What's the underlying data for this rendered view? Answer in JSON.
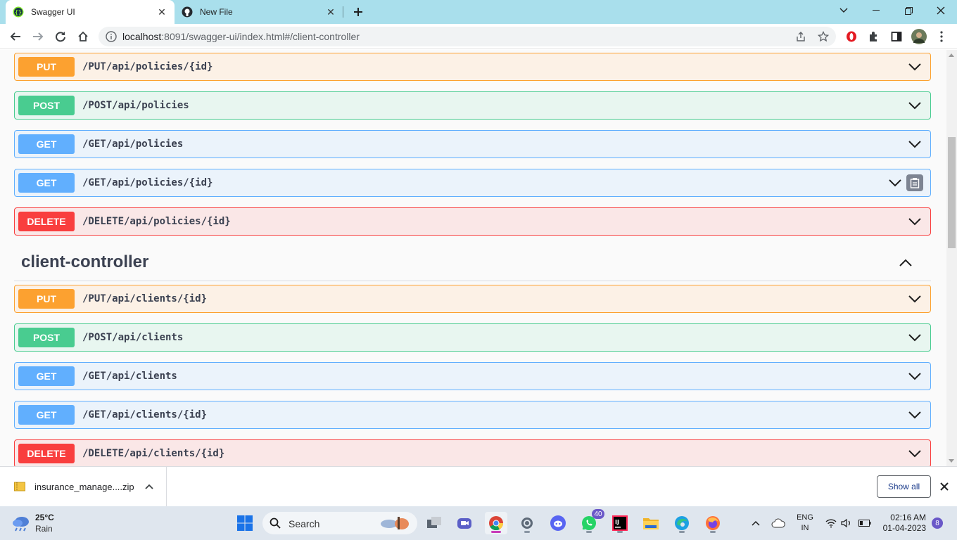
{
  "browser": {
    "tabs": [
      {
        "title": "Swagger UI",
        "active": true,
        "icon": "swagger-icon"
      },
      {
        "title": "New File",
        "active": false,
        "icon": "github-icon"
      }
    ],
    "url_host": "localhost",
    "url_rest": ":8091/swagger-ui/index.html#/client-controller"
  },
  "operations_top": [
    {
      "method": "PUT",
      "path": "/PUT/api/policies/{id}"
    },
    {
      "method": "POST",
      "path": "/POST/api/policies"
    },
    {
      "method": "GET",
      "path": "/GET/api/policies"
    },
    {
      "method": "GET",
      "path": "/GET/api/policies/{id}"
    },
    {
      "method": "DELETE",
      "path": "/DELETE/api/policies/{id}"
    }
  ],
  "section": {
    "title": "client-controller",
    "expanded": true
  },
  "operations_client": [
    {
      "method": "PUT",
      "path": "/PUT/api/clients/{id}"
    },
    {
      "method": "POST",
      "path": "/POST/api/clients"
    },
    {
      "method": "GET",
      "path": "/GET/api/clients"
    },
    {
      "method": "GET",
      "path": "/GET/api/clients/{id}"
    },
    {
      "method": "DELETE",
      "path": "/DELETE/api/clients/{id}"
    }
  ],
  "download": {
    "file_name": "insurance_manage....zip",
    "show_all": "Show all"
  },
  "taskbar": {
    "weather": {
      "temp": "25°C",
      "condition": "Rain"
    },
    "search_label": "Search",
    "whatsapp_badge": "40",
    "lang_line1": "ENG",
    "lang_line2": "IN",
    "time": "02:16 AM",
    "date": "01-04-2023",
    "notification_count": "8"
  },
  "colors": {
    "put": "#fca130",
    "post": "#49cc90",
    "get": "#61affe",
    "delete": "#f93e3e"
  }
}
